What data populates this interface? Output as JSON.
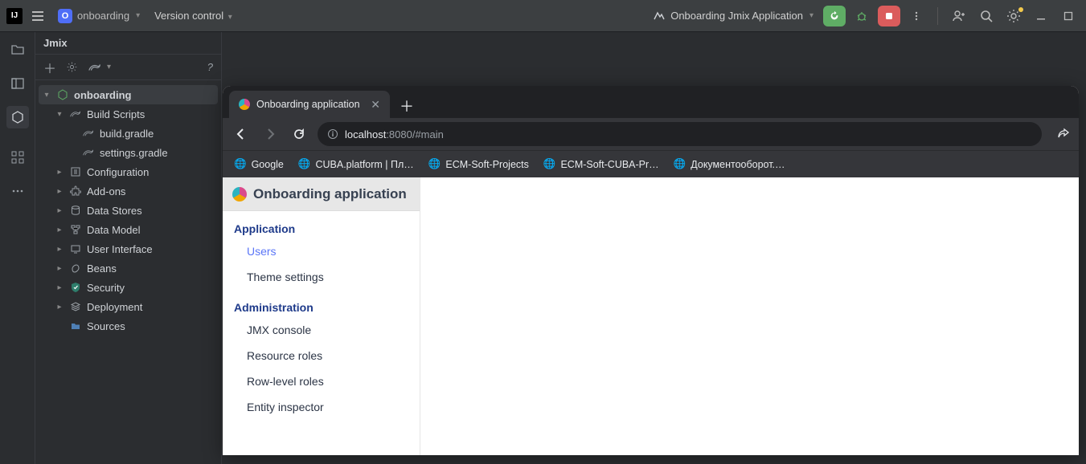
{
  "titlebar": {
    "project_initial": "O",
    "project_name": "onboarding",
    "vcs_label": "Version control",
    "run_config": "Onboarding Jmix Application"
  },
  "panel": {
    "tab": "Jmix",
    "toolbar_help": "?"
  },
  "tree": {
    "root": "onboarding",
    "build_scripts": "Build Scripts",
    "build_gradle": "build.gradle",
    "settings_gradle": "settings.gradle",
    "configuration": "Configuration",
    "addons": "Add-ons",
    "data_stores": "Data Stores",
    "data_model": "Data Model",
    "ui": "User Interface",
    "beans": "Beans",
    "security": "Security",
    "deployment": "Deployment",
    "sources": "Sources"
  },
  "browser": {
    "tab_title": "Onboarding application",
    "url_host": "localhost",
    "url_rest": ":8080/#main",
    "bookmarks": [
      "Google",
      "CUBA.platform | Пл…",
      "ECM-Soft-Projects",
      "ECM-Soft-CUBA-Pr…",
      "Документооборот.…"
    ]
  },
  "app": {
    "title": "Onboarding application",
    "sections": [
      {
        "label": "Application",
        "items": [
          "Users",
          "Theme settings"
        ],
        "active": "Users"
      },
      {
        "label": "Administration",
        "items": [
          "JMX console",
          "Resource roles",
          "Row-level roles",
          "Entity inspector"
        ]
      }
    ]
  }
}
